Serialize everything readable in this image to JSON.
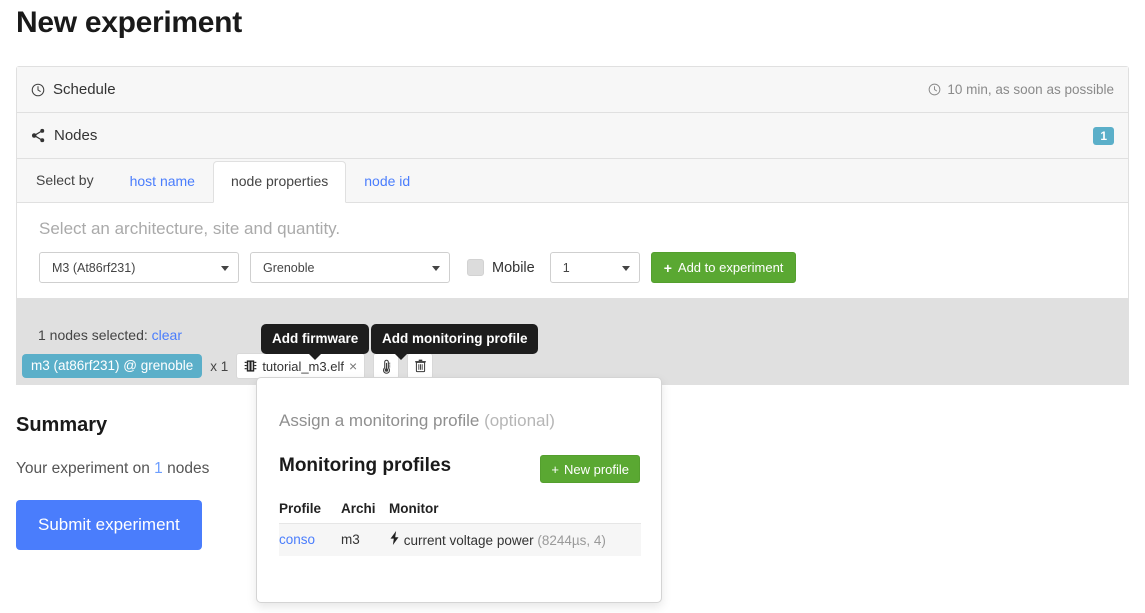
{
  "page": {
    "title": "New experiment"
  },
  "schedule": {
    "label": "Schedule",
    "icon": "clock-icon",
    "value": "10 min, as soon as possible"
  },
  "nodes": {
    "label": "Nodes",
    "icon": "share-nodes-icon",
    "count_badge": "1",
    "select_by_label": "Select by",
    "tabs": [
      {
        "label": "host name",
        "active": false
      },
      {
        "label": "node properties",
        "active": true
      },
      {
        "label": "node id",
        "active": false
      }
    ],
    "form": {
      "hint": "Select an architecture, site and quantity.",
      "architecture": "M3 (At86rf231)",
      "site": "Grenoble",
      "mobile_label": "Mobile",
      "mobile_checked": false,
      "quantity": "1",
      "add_button": "Add to experiment",
      "add_button_icon": "plus-icon"
    },
    "selection": {
      "summary_prefix": "1 nodes selected:",
      "clear_label": "clear",
      "chip": "m3 (at86rf231) @ grenoble",
      "multiplier": "x 1",
      "firmware": "tutorial_m3.elf",
      "firmware_icon": "chip-icon",
      "firmware_remove": "×",
      "monitoring_icon": "thermometer-icon",
      "delete_icon": "trash-icon"
    },
    "tooltips": {
      "firmware": "Add firmware",
      "monitoring": "Add monitoring profile"
    }
  },
  "popover": {
    "subtitle_main": "Assign a monitoring profile",
    "subtitle_optional": "(optional)",
    "title": "Monitoring profiles",
    "new_button": "New profile",
    "new_button_icon": "plus-icon",
    "table": {
      "headers": [
        "Profile",
        "Archi",
        "Monitor"
      ],
      "rows": [
        {
          "profile": "conso",
          "archi": "m3",
          "monitor_icon": "bolt-icon",
          "monitor": "current voltage power",
          "monitor_params": "(8244µs, 4)"
        }
      ]
    }
  },
  "summary": {
    "heading": "Summary",
    "text_prefix": "Your experiment on",
    "node_count": "1",
    "text_suffix": "nodes",
    "submit_label": "Submit experiment"
  },
  "colors": {
    "accent_blue": "#4a7dfc",
    "green": "#5aa832",
    "info_teal": "#5bafc9",
    "band_gray": "#e0e0e0",
    "tooltip_black": "#1d1d1d"
  }
}
